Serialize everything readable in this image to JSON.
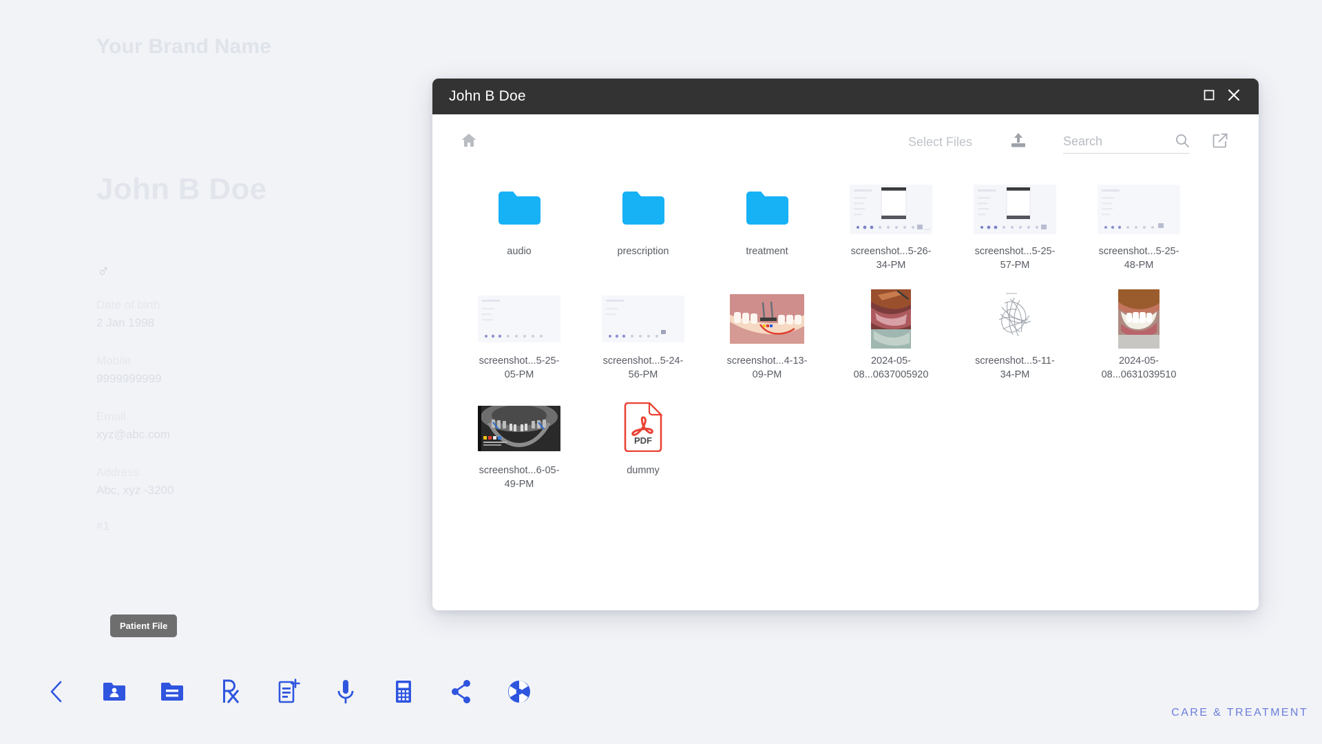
{
  "app": {
    "brand_name": "Your Brand Name",
    "footer_text": "CARE & TREATMENT",
    "background_color": "#f2f3f7",
    "accent_color": "#2f55df",
    "folder_color": "#17b1f5"
  },
  "patient": {
    "name": "John B Doe",
    "gender_icon": "male-icon",
    "gender_symbol": "♂",
    "fields": [
      {
        "label": "Date of birth",
        "value": "2 Jan 1998"
      },
      {
        "label": "Mobile",
        "value": "9999999999"
      },
      {
        "label": "Email",
        "value": "xyz@abc.com"
      },
      {
        "label": "Address",
        "value": "Abc, xyz -3200"
      }
    ],
    "record_id": "#1"
  },
  "tooltip": {
    "label": "Patient File"
  },
  "bottom_nav": {
    "items": [
      {
        "icon": "back-chevron-icon",
        "name": "back-button"
      },
      {
        "icon": "patient-folder-icon",
        "name": "patient-file-button"
      },
      {
        "icon": "folder-icon",
        "name": "files-button"
      },
      {
        "icon": "rx-icon",
        "name": "prescription-button"
      },
      {
        "icon": "note-add-icon",
        "name": "new-note-button"
      },
      {
        "icon": "microphone-icon",
        "name": "audio-record-button"
      },
      {
        "icon": "calculator-icon",
        "name": "billing-button"
      },
      {
        "icon": "share-icon",
        "name": "share-button"
      },
      {
        "icon": "camera-aperture-icon",
        "name": "camera-button"
      }
    ]
  },
  "dialog": {
    "title": "John B Doe",
    "title_bar_color": "#333333",
    "window_controls": [
      {
        "icon": "maximize-icon",
        "name": "maximize-button"
      },
      {
        "icon": "close-icon",
        "name": "close-button"
      }
    ],
    "toolbar": {
      "home_icon": "home-icon",
      "select_files_label": "Select Files",
      "upload_icon": "upload-icon",
      "search": {
        "placeholder": "Search",
        "value": "",
        "icon": "search-icon"
      },
      "external_link_icon": "external-link-icon"
    },
    "files": [
      {
        "name": "audio",
        "type": "folder"
      },
      {
        "name": "prescription",
        "type": "folder"
      },
      {
        "name": "treatment",
        "type": "folder"
      },
      {
        "name": "screenshot...5-26-34-PM",
        "type": "image",
        "thumb": "app-screenshot-phone"
      },
      {
        "name": "screenshot...5-25-57-PM",
        "type": "image",
        "thumb": "app-screenshot-phone"
      },
      {
        "name": "screenshot...5-25-48-PM",
        "type": "image",
        "thumb": "app-screenshot-plain"
      },
      {
        "name": "screenshot...5-25-05-PM",
        "type": "image",
        "thumb": "app-screenshot-plain"
      },
      {
        "name": "screenshot...5-24-56-PM",
        "type": "image",
        "thumb": "app-screenshot-plain"
      },
      {
        "name": "screenshot...4-13-09-PM",
        "type": "image",
        "thumb": "dental-diagram"
      },
      {
        "name": "2024-05-08...0637005920",
        "type": "image",
        "thumb": "intraoral-photo-dark"
      },
      {
        "name": "screenshot...5-11-34-PM",
        "type": "image",
        "thumb": "sketch-drawing"
      },
      {
        "name": "2024-05-08...0631039510",
        "type": "image",
        "thumb": "smile-photo"
      },
      {
        "name": "screenshot...6-05-49-PM",
        "type": "image",
        "thumb": "opg-xray"
      },
      {
        "name": "dummy",
        "type": "pdf",
        "thumb": "pdf-icon",
        "badge": "PDF"
      }
    ]
  }
}
